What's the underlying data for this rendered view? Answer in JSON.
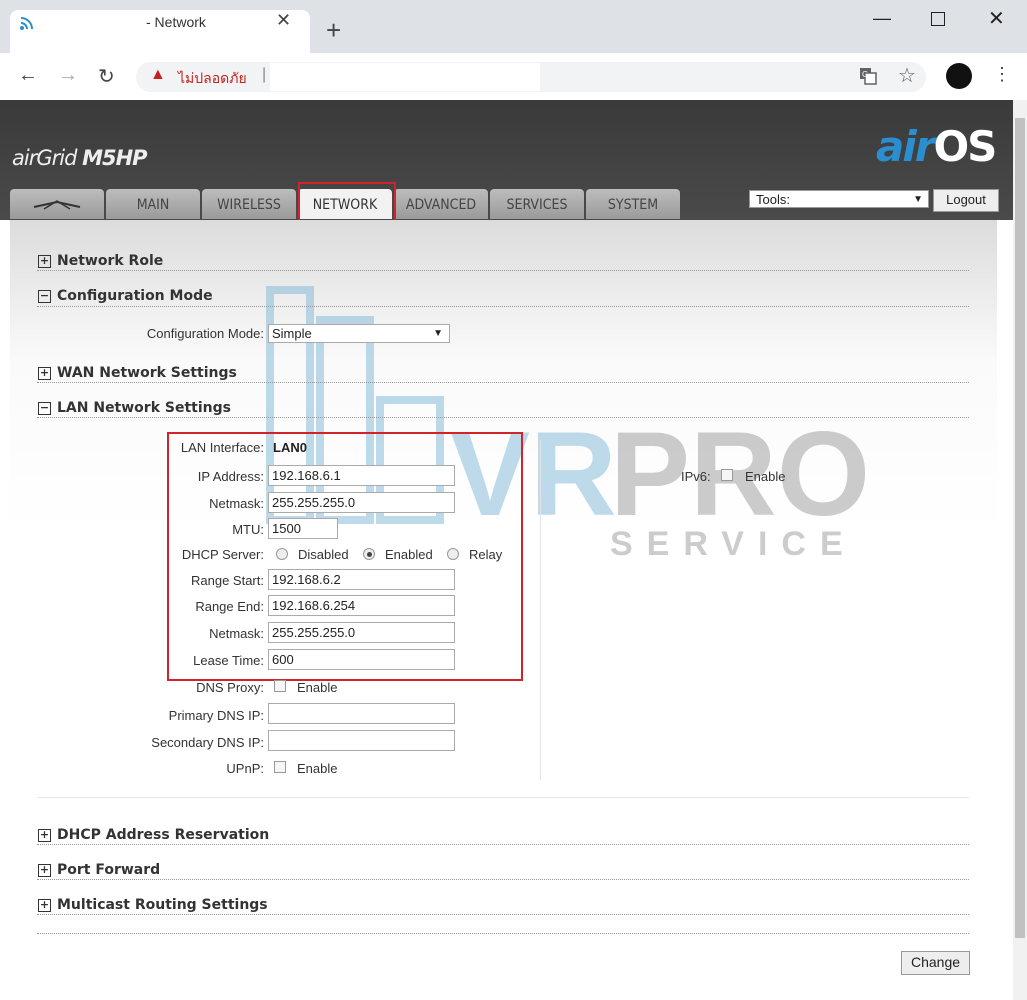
{
  "browser": {
    "tab_title": "- Network",
    "tab_close": "✕",
    "new_tab": "+",
    "security_text": "ไม่ปลอดภัย",
    "separator": "|",
    "window_minimize": "—",
    "window_close": "✕"
  },
  "header": {
    "brand_prefix": "airGrid ",
    "brand_model": "M5HP",
    "logo_air": "air",
    "logo_os": "OS",
    "tools_label": "Tools:",
    "logout_label": "Logout"
  },
  "nav_tabs": [
    {
      "label": "MAIN"
    },
    {
      "label": "WIRELESS"
    },
    {
      "label": "NETWORK",
      "active": true
    },
    {
      "label": "ADVANCED"
    },
    {
      "label": "SERVICES"
    },
    {
      "label": "SYSTEM"
    }
  ],
  "sections": {
    "network_role": "Network Role",
    "configuration_mode": "Configuration Mode",
    "wan": "WAN Network Settings",
    "lan": "LAN Network Settings",
    "dhcp_reservation": "DHCP Address Reservation",
    "port_forward": "Port Forward",
    "multicast": "Multicast Routing Settings"
  },
  "config_mode": {
    "label": "Configuration Mode:",
    "value": "Simple"
  },
  "lan": {
    "interface_label": "LAN Interface:",
    "interface_value": "LAN0",
    "ip_label": "IP Address:",
    "ip_value": "192.168.6.1",
    "netmask_label": "Netmask:",
    "netmask_value": "255.255.255.0",
    "mtu_label": "MTU:",
    "mtu_value": "1500",
    "dhcp_label": "DHCP Server:",
    "dhcp_options": [
      "Disabled",
      "Enabled",
      "Relay"
    ],
    "dhcp_selected": "Enabled",
    "range_start_label": "Range Start:",
    "range_start_value": "192.168.6.2",
    "range_end_label": "Range End:",
    "range_end_value": "192.168.6.254",
    "dhcp_netmask_label": "Netmask:",
    "dhcp_netmask_value": "255.255.255.0",
    "lease_label": "Lease Time:",
    "lease_value": "600",
    "dns_proxy_label": "DNS Proxy:",
    "enable_text": "Enable",
    "primary_dns_label": "Primary DNS IP:",
    "secondary_dns_label": "Secondary DNS IP:",
    "upnp_label": "UPnP:",
    "ipv6_label": "IPv6:"
  },
  "watermark": {
    "line1": "VRPRO",
    "line2": "SERVICE"
  },
  "change_label": "Change"
}
